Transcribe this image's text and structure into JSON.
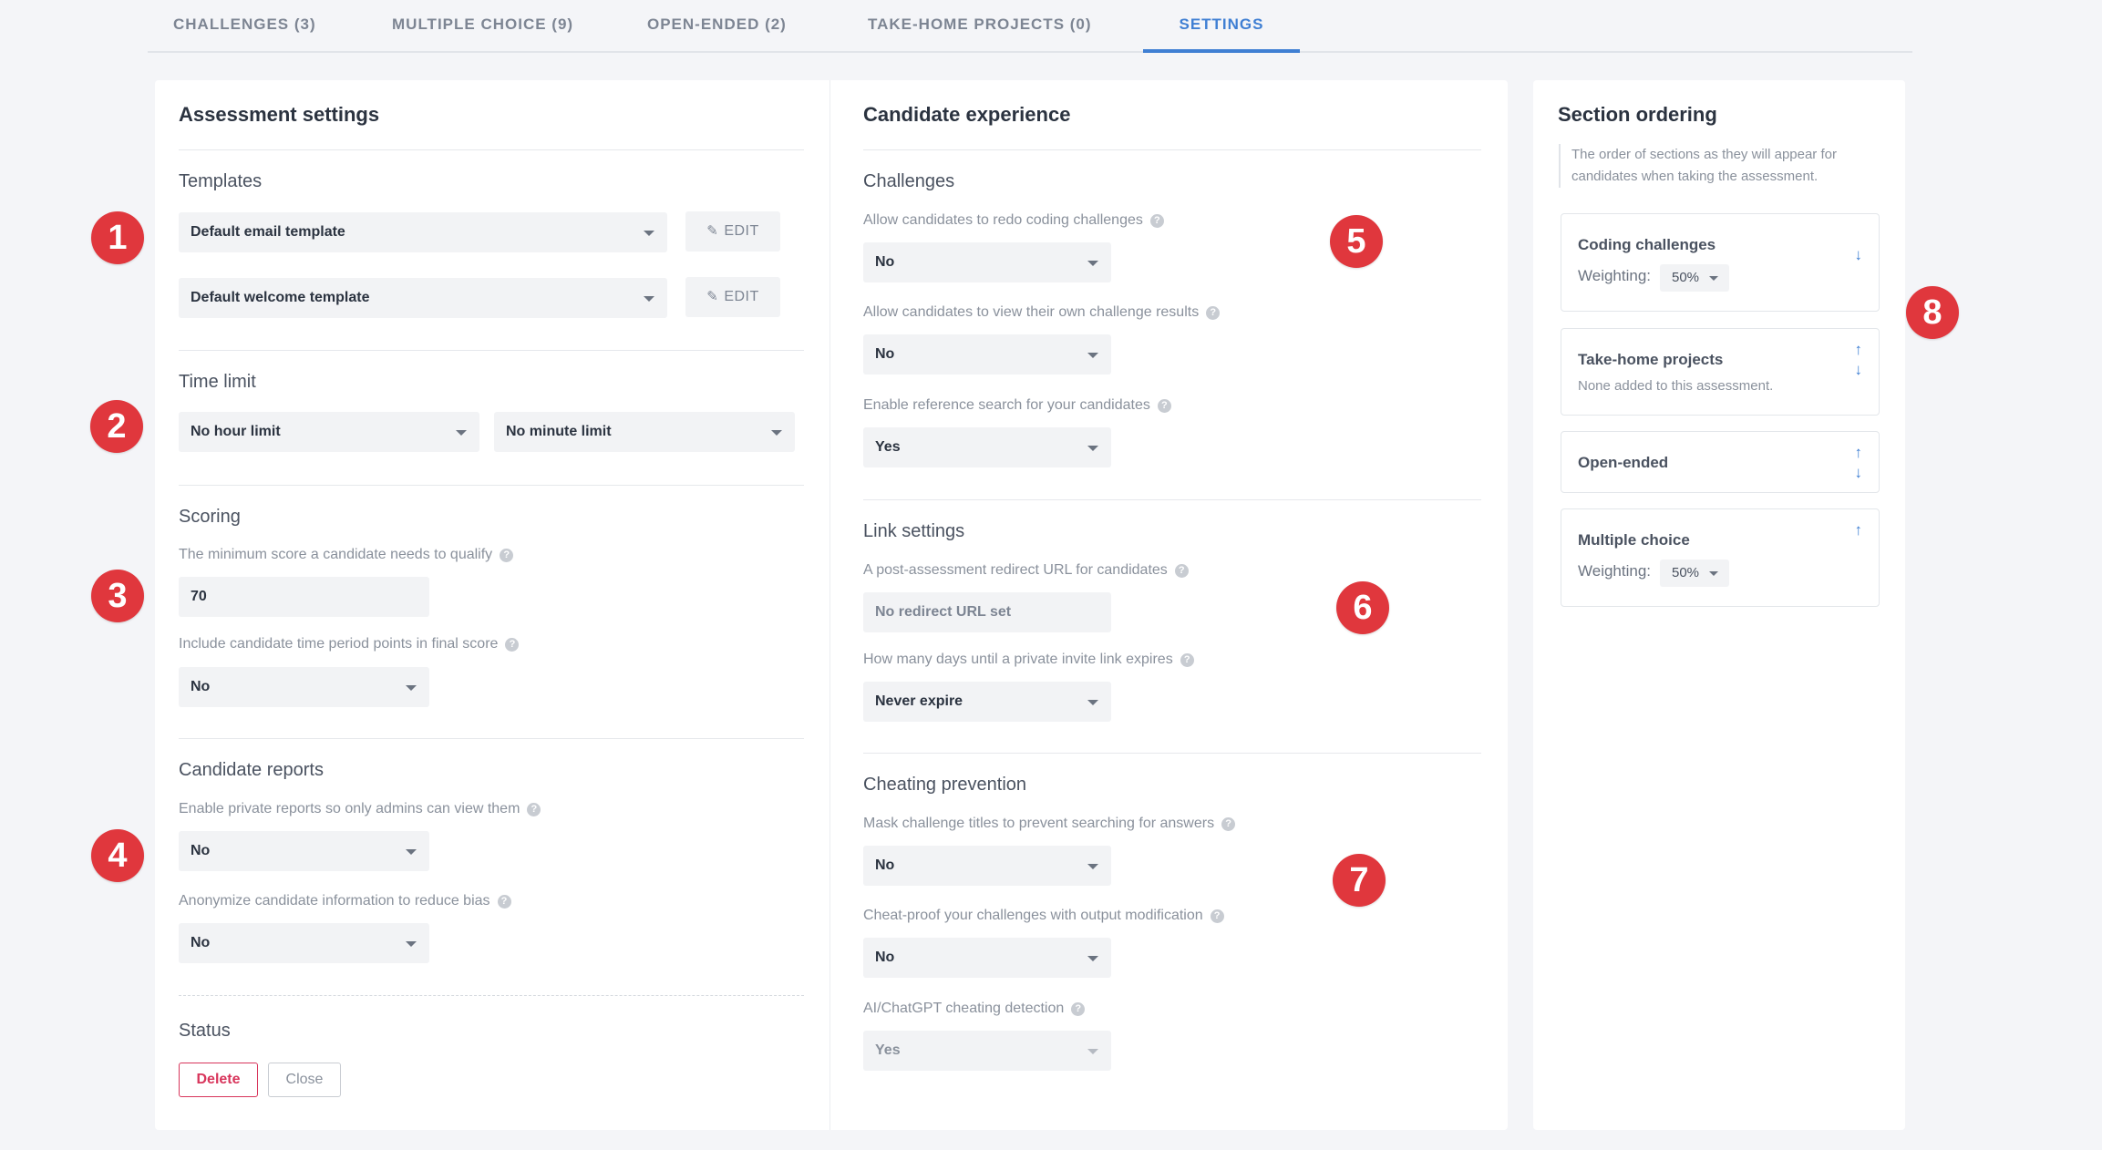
{
  "tabs": [
    "CHALLENGES (3)",
    "MULTIPLE CHOICE (9)",
    "OPEN-ENDED (2)",
    "TAKE-HOME PROJECTS (0)",
    "SETTINGS"
  ],
  "badges": [
    "1",
    "2",
    "3",
    "4",
    "5",
    "6",
    "7",
    "8"
  ],
  "assessment": {
    "title": "Assessment settings",
    "templates": {
      "heading": "Templates",
      "email": "Default email template",
      "welcome": "Default welcome template",
      "edit_label": "EDIT"
    },
    "time_limit": {
      "heading": "Time limit",
      "hours": "No hour limit",
      "minutes": "No minute limit"
    },
    "scoring": {
      "heading": "Scoring",
      "min_score_label": "The minimum score a candidate needs to qualify",
      "min_score": "70",
      "time_points_label": "Include candidate time period points in final score",
      "time_points": "No"
    },
    "reports": {
      "heading": "Candidate reports",
      "private_label": "Enable private reports so only admins can view them",
      "private": "No",
      "anonymize_label": "Anonymize candidate information to reduce bias",
      "anonymize": "No"
    },
    "status": {
      "heading": "Status",
      "delete": "Delete",
      "close": "Close"
    }
  },
  "candidate": {
    "title": "Candidate experience",
    "challenges": {
      "heading": "Challenges",
      "redo_label": "Allow candidates to redo coding challenges",
      "redo": "No",
      "view_label": "Allow candidates to view their own challenge results",
      "view": "No",
      "reference_label": "Enable reference search for your candidates",
      "reference": "Yes"
    },
    "links": {
      "heading": "Link settings",
      "redirect_label": "A post-assessment redirect URL for candidates",
      "redirect": "No redirect URL set",
      "expire_label": "How many days until a private invite link expires",
      "expire": "Never expire"
    },
    "cheating": {
      "heading": "Cheating prevention",
      "mask_label": "Mask challenge titles to prevent searching for answers",
      "mask": "No",
      "cheatproof_label": "Cheat-proof your challenges with output modification",
      "cheatproof": "No",
      "ai_label": "AI/ChatGPT cheating detection",
      "ai": "Yes"
    }
  },
  "ordering": {
    "title": "Section ordering",
    "description": "The order of sections as they will appear for candidates when taking the assessment.",
    "weighting_label": "Weighting:",
    "sections": [
      {
        "title": "Coding challenges",
        "weighting": "50%"
      },
      {
        "title": "Take-home projects",
        "subtitle": "None added to this assessment."
      },
      {
        "title": "Open-ended"
      },
      {
        "title": "Multiple choice",
        "weighting": "50%"
      }
    ]
  },
  "colors": {
    "accent": "#3f7fd3",
    "badge": "#e0373d",
    "danger": "#d8355b"
  }
}
